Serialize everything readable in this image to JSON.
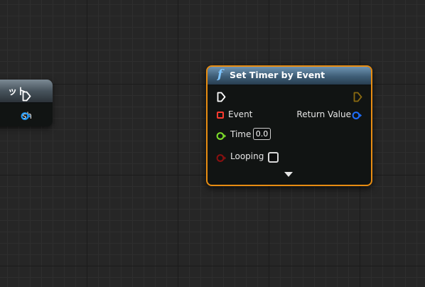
{
  "left_node": {
    "title": "ット",
    "pin_label": "sh",
    "pin_color": "#1f9bff"
  },
  "main_node": {
    "icon": "function-icon",
    "title": "Set Timer by Event",
    "pins": {
      "event_label": "Event",
      "return_label": "Return Value",
      "time_label": "Time",
      "time_value": "0.0",
      "looping_label": "Looping",
      "looping_checked": false
    },
    "colors": {
      "border": "#e88d12",
      "event_pin": "#ff3b30",
      "time_pin": "#7ee02a",
      "loop_pin": "#8a1010",
      "return_pin": "#1f6fff",
      "exec_out": "#8a6a10"
    }
  }
}
